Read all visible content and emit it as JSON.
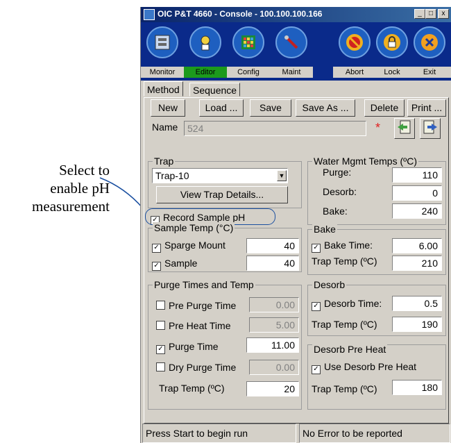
{
  "callout": {
    "line1": "Select to",
    "line2": "enable pH",
    "line3": "measurement"
  },
  "window": {
    "title": "OIC P&T 4660 - Console - 100.100.100.166",
    "btn_min": "_",
    "btn_max": "□",
    "btn_close": "x"
  },
  "toolbar": {
    "monitor": {
      "label": "Monitor",
      "icon": "monitor-icon"
    },
    "editor": {
      "label": "Editor",
      "icon": "editor-icon"
    },
    "config": {
      "label": "Config",
      "icon": "config-icon"
    },
    "maint": {
      "label": "Maint",
      "icon": "wrench-icon"
    },
    "abort": {
      "label": "Abort",
      "icon": "abort-icon"
    },
    "lock": {
      "label": "Lock",
      "icon": "lock-icon"
    },
    "exit": {
      "label": "Exit",
      "icon": "close-icon"
    }
  },
  "tabs": {
    "method": "Method",
    "sequence": "Sequence"
  },
  "buttons": {
    "new": "New",
    "load": "Load ...",
    "save": "Save",
    "save_as": "Save As ...",
    "delete": "Delete",
    "print": "Print ..."
  },
  "name": {
    "label": "Name",
    "value": "524",
    "modified": "*"
  },
  "trap": {
    "title": "Trap",
    "selected": "Trap-10",
    "details": "View Trap Details...",
    "record_ph": "Record Sample pH",
    "record_ph_checked": true
  },
  "water": {
    "title": "Water Mgmt Temps (ºC)",
    "purge_label": "Purge:",
    "purge": "110",
    "desorb_label": "Desorb:",
    "desorb": "0",
    "bake_label": "Bake:",
    "bake": "240"
  },
  "sample_temp": {
    "title": "Sample Temp (°C)",
    "sparge_label": "Sparge Mount",
    "sparge": "40",
    "sample_label": "Sample",
    "sample": "40"
  },
  "bake": {
    "title": "Bake",
    "time_label": "Bake Time:",
    "time": "6.00",
    "trap_label": "Trap Temp (ºC)",
    "trap": "210"
  },
  "purge": {
    "title": "Purge Times and Temp",
    "pre_purge_label": "Pre Purge Time",
    "pre_purge": "0.00",
    "pre_heat_label": "Pre Heat Time",
    "pre_heat": "5.00",
    "purge_label": "Purge Time",
    "purge_time": "11.00",
    "dry_label": "Dry Purge Time",
    "dry": "0.00",
    "trap_label": "Trap Temp (ºC)",
    "trap": "20"
  },
  "desorb": {
    "title": "Desorb",
    "time_label": "Desorb Time:",
    "time": "0.5",
    "trap_label": "Trap Temp (ºC)",
    "trap": "190"
  },
  "desorb_preheat": {
    "title": "Desorb Pre Heat",
    "use_label": "Use Desorb Pre Heat",
    "trap_label": "Trap Temp (ºC)",
    "trap": "180"
  },
  "status": {
    "left": "Press Start to begin run",
    "right": "No Error to be reported"
  },
  "colors": {
    "callout": "#1a4fa0",
    "check": "☑"
  }
}
